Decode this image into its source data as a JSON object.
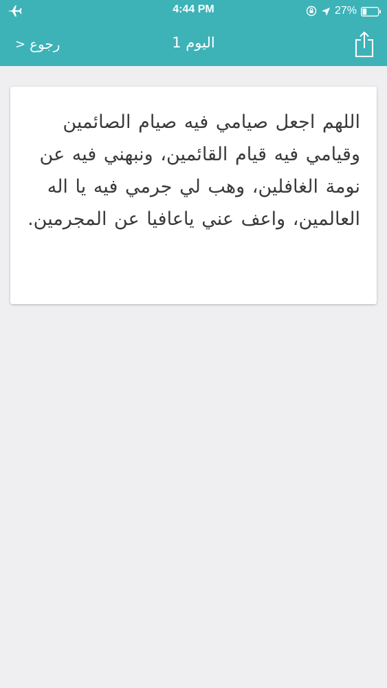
{
  "status_bar": {
    "time": "4:44 PM",
    "battery_percent": "27%",
    "battery_level": 0.27,
    "icons": [
      "airplane-icon",
      "orientation-lock-icon",
      "location-arrow-icon",
      "battery-icon"
    ]
  },
  "nav": {
    "title": "اليوم 1",
    "back_label": "رجوع",
    "back_chevron": ">",
    "share_icon": "share-icon"
  },
  "content": {
    "text": "اللهم اجعل صيامي فيه صيام الصائمين وقيامي فيه قيام القائمين، ونبهني فيه عن نومة الغافلين، وهب لي جرمي فيه يا اله العالمين، واعف عني ياعافيا عن المجرمين."
  },
  "colors": {
    "header_bg": "#3db3b8",
    "page_bg": "#efeef0",
    "card_bg": "#ffffff",
    "text": "#3a3a3a"
  }
}
